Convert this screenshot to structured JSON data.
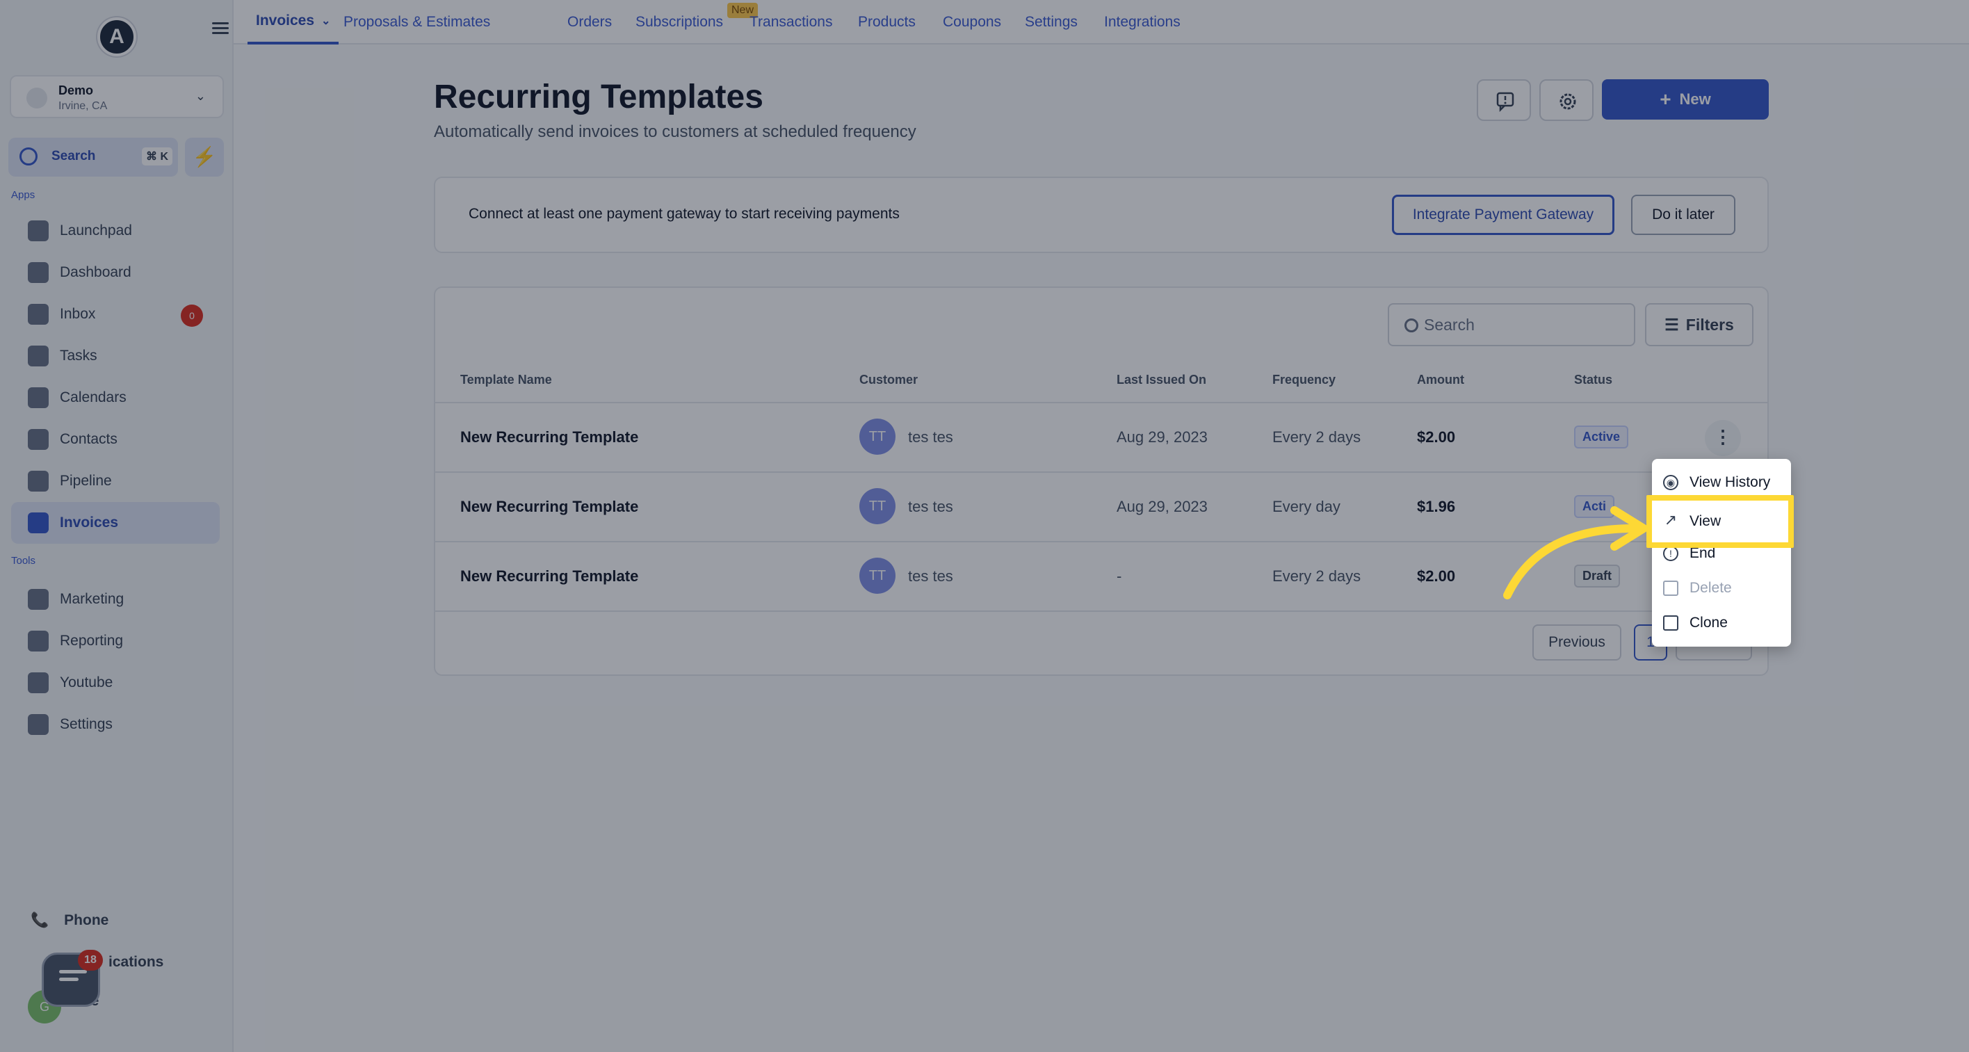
{
  "topnav": {
    "tabs": [
      {
        "label": "Invoices"
      },
      {
        "label": "Proposals & Estimates"
      },
      {
        "label": "Orders"
      },
      {
        "label": "Subscriptions"
      },
      {
        "label": "Transactions"
      },
      {
        "label": "Products"
      },
      {
        "label": "Coupons"
      },
      {
        "label": "Settings"
      },
      {
        "label": "Integrations"
      }
    ],
    "new_tag": "New"
  },
  "sidebar": {
    "logo": "A",
    "account": {
      "name": "Demo",
      "location": "Irvine, CA"
    },
    "search": {
      "label": "Search",
      "shortcut": "⌘ K"
    },
    "section_apps": "Apps",
    "apps": [
      {
        "label": "Launchpad"
      },
      {
        "label": "Dashboard"
      },
      {
        "label": "Inbox"
      },
      {
        "label": "Tasks"
      },
      {
        "label": "Calendars"
      },
      {
        "label": "Contacts"
      },
      {
        "label": "Pipeline"
      },
      {
        "label": "Invoices"
      }
    ],
    "inbox_count": "0",
    "section_tools": "Tools",
    "tools": [
      {
        "label": "Marketing"
      },
      {
        "label": "Reporting"
      },
      {
        "label": "Youtube"
      },
      {
        "label": "Settings"
      }
    ],
    "bottom": [
      {
        "label": "Phone"
      },
      {
        "label": "ications"
      },
      {
        "label": "file"
      }
    ],
    "chat_count": "18",
    "profile_initials": "G"
  },
  "page": {
    "title": "Recurring Templates",
    "subtitle": "Automatically send invoices to customers at scheduled frequency",
    "new_button": "New"
  },
  "gateway": {
    "message": "Connect at least one payment gateway to start receiving payments",
    "integrate_label": "Integrate Payment Gateway",
    "later_label": "Do it later"
  },
  "table": {
    "search_placeholder": "Search",
    "filters_label": "Filters",
    "headers": [
      "Template Name",
      "Customer",
      "Last Issued On",
      "Frequency",
      "Amount",
      "Status"
    ],
    "rows": [
      {
        "name": "New Recurring Template",
        "initials": "TT",
        "customer": "tes tes",
        "last_issued": "Aug 29, 2023",
        "frequency": "Every 2 days",
        "amount": "$2.00",
        "status": "Active"
      },
      {
        "name": "New Recurring Template",
        "initials": "TT",
        "customer": "tes tes",
        "last_issued": "Aug 29, 2023",
        "frequency": "Every day",
        "amount": "$1.96",
        "status": "Acti"
      },
      {
        "name": "New Recurring Template",
        "initials": "TT",
        "customer": "tes tes",
        "last_issued": "-",
        "frequency": "Every 2 days",
        "amount": "$2.00",
        "status": "Draft"
      }
    ],
    "pagination": {
      "previous": "Previous",
      "page": "1"
    }
  },
  "row_menu": {
    "items": [
      {
        "label": "View History",
        "icon": "eye-icon"
      },
      {
        "label": "View",
        "icon": "arrow-up-right-icon"
      },
      {
        "label": "End",
        "icon": "stop-circle-icon"
      },
      {
        "label": "Delete",
        "icon": "trash-icon"
      },
      {
        "label": "Clone",
        "icon": "copy-icon"
      }
    ]
  },
  "colors": {
    "accent": "#3557c9",
    "highlight": "#fdd835",
    "danger": "#d92d20"
  }
}
